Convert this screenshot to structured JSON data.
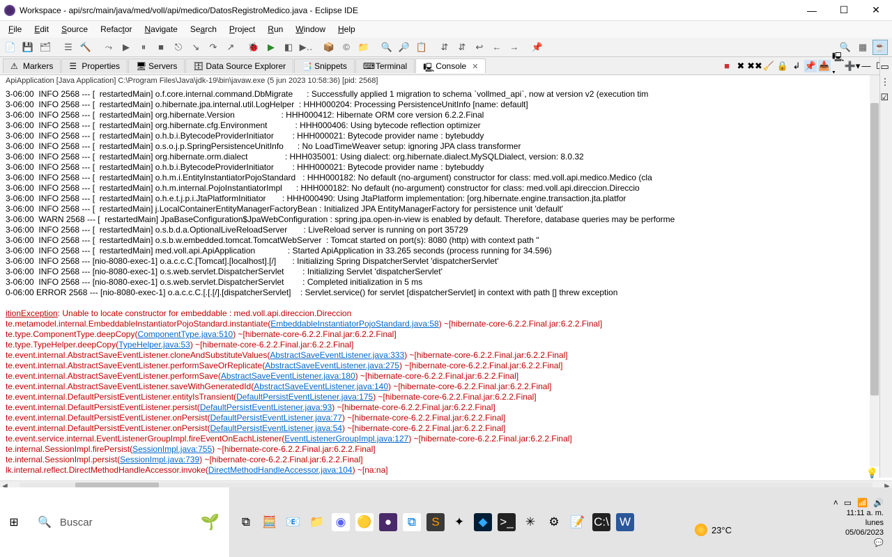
{
  "window": {
    "title": "Workspace - api/src/main/java/med/voll/api/medico/DatosRegistroMedico.java - Eclipse IDE"
  },
  "menu": {
    "file": "File",
    "edit": "Edit",
    "source": "Source",
    "refactor": "Refactor",
    "navigate": "Navigate",
    "search": "Search",
    "project": "Project",
    "run": "Run",
    "window": "Window",
    "help": "Help"
  },
  "tabs": {
    "markers": "Markers",
    "properties": "Properties",
    "servers": "Servers",
    "data_source_explorer": "Data Source Explorer",
    "snippets": "Snippets",
    "terminal": "Terminal",
    "console": "Console"
  },
  "console_header": "ApiApplication [Java Application] C:\\Program Files\\Java\\jdk-19\\bin\\javaw.exe (5 jun 2023 10:58:36) [pid: 2568]",
  "log_lines": [
    "3-06:00  INFO 2568 --- [  restartedMain] o.f.core.internal.command.DbMigrate      : Successfully applied 1 migration to schema `vollmed_api`, now at version v2 (execution tim",
    "3-06:00  INFO 2568 --- [  restartedMain] o.hibernate.jpa.internal.util.LogHelper  : HHH000204: Processing PersistenceUnitInfo [name: default]",
    "3-06:00  INFO 2568 --- [  restartedMain] org.hibernate.Version                    : HHH000412: Hibernate ORM core version 6.2.2.Final",
    "3-06:00  INFO 2568 --- [  restartedMain] org.hibernate.cfg.Environment            : HHH000406: Using bytecode reflection optimizer",
    "3-06:00  INFO 2568 --- [  restartedMain] o.h.b.i.BytecodeProviderInitiator        : HHH000021: Bytecode provider name : bytebuddy",
    "3-06:00  INFO 2568 --- [  restartedMain] o.s.o.j.p.SpringPersistenceUnitInfo      : No LoadTimeWeaver setup: ignoring JPA class transformer",
    "3-06:00  INFO 2568 --- [  restartedMain] org.hibernate.orm.dialect                : HHH035001: Using dialect: org.hibernate.dialect.MySQLDialect, version: 8.0.32",
    "3-06:00  INFO 2568 --- [  restartedMain] o.h.b.i.BytecodeProviderInitiator        : HHH000021: Bytecode provider name : bytebuddy",
    "3-06:00  INFO 2568 --- [  restartedMain] o.h.m.i.EntityInstantiatorPojoStandard   : HHH000182: No default (no-argument) constructor for class: med.voll.api.medico.Medico (cla",
    "3-06:00  INFO 2568 --- [  restartedMain] o.h.m.internal.PojoInstantiatorImpl      : HHH000182: No default (no-argument) constructor for class: med.voll.api.direccion.Direccio",
    "3-06:00  INFO 2568 --- [  restartedMain] o.h.e.t.j.p.i.JtaPlatformInitiator       : HHH000490: Using JtaPlatform implementation: [org.hibernate.engine.transaction.jta.platfor",
    "3-06:00  INFO 2568 --- [  restartedMain] j.LocalContainerEntityManagerFactoryBean : Initialized JPA EntityManagerFactory for persistence unit 'default'",
    "3-06:00  WARN 2568 --- [  restartedMain] JpaBaseConfiguration$JpaWebConfiguration : spring.jpa.open-in-view is enabled by default. Therefore, database queries may be performe",
    "3-06:00  INFO 2568 --- [  restartedMain] o.s.b.d.a.OptionalLiveReloadServer       : LiveReload server is running on port 35729",
    "3-06:00  INFO 2568 --- [  restartedMain] o.s.b.w.embedded.tomcat.TomcatWebServer  : Tomcat started on port(s): 8080 (http) with context path ''",
    "3-06:00  INFO 2568 --- [  restartedMain] med.voll.api.ApiApplication              : Started ApiApplication in 33.265 seconds (process running for 34.596)",
    "3-06:00  INFO 2568 --- [nio-8080-exec-1] o.a.c.c.C.[Tomcat].[localhost].[/]       : Initializing Spring DispatcherServlet 'dispatcherServlet'",
    "3-06:00  INFO 2568 --- [nio-8080-exec-1] o.s.web.servlet.DispatcherServlet        : Initializing Servlet 'dispatcherServlet'",
    "3-06:00  INFO 2568 --- [nio-8080-exec-1] o.s.web.servlet.DispatcherServlet        : Completed initialization in 5 ms",
    "0-06:00 ERROR 2568 --- [nio-8080-exec-1] o.a.c.c.C.[.[.[/].[dispatcherServlet]    : Servlet.service() for servlet [dispatcherServlet] in context with path [] threw exception"
  ],
  "stack": {
    "head_a": "itionException",
    "head_b": ": Unable to locate constructor for embeddable : med.voll.api.direccion.Direccion",
    "lines": [
      {
        "pre": "te.metamodel.internal.EmbeddableInstantiatorPojoStandard.instantiate(",
        "link": "EmbeddableInstantiatorPojoStandard.java:58",
        "post": ") ~[hibernate-core-6.2.2.Final.jar:6.2.2.Final]"
      },
      {
        "pre": "te.type.ComponentType.deepCopy(",
        "link": "ComponentType.java:510",
        "post": ") ~[hibernate-core-6.2.2.Final.jar:6.2.2.Final]"
      },
      {
        "pre": "te.type.TypeHelper.deepCopy(",
        "link": "TypeHelper.java:53",
        "post": ") ~[hibernate-core-6.2.2.Final.jar:6.2.2.Final]"
      },
      {
        "pre": "te.event.internal.AbstractSaveEventListener.cloneAndSubstituteValues(",
        "link": "AbstractSaveEventListener.java:333",
        "post": ") ~[hibernate-core-6.2.2.Final.jar:6.2.2.Final]"
      },
      {
        "pre": "te.event.internal.AbstractSaveEventListener.performSaveOrReplicate(",
        "link": "AbstractSaveEventListener.java:275",
        "post": ") ~[hibernate-core-6.2.2.Final.jar:6.2.2.Final]"
      },
      {
        "pre": "te.event.internal.AbstractSaveEventListener.performSave(",
        "link": "AbstractSaveEventListener.java:180",
        "post": ") ~[hibernate-core-6.2.2.Final.jar:6.2.2.Final]"
      },
      {
        "pre": "te.event.internal.AbstractSaveEventListener.saveWithGeneratedId(",
        "link": "AbstractSaveEventListener.java:140",
        "post": ") ~[hibernate-core-6.2.2.Final.jar:6.2.2.Final]"
      },
      {
        "pre": "te.event.internal.DefaultPersistEventListener.entityIsTransient(",
        "link": "DefaultPersistEventListener.java:175",
        "post": ") ~[hibernate-core-6.2.2.Final.jar:6.2.2.Final]"
      },
      {
        "pre": "te.event.internal.DefaultPersistEventListener.persist(",
        "link": "DefaultPersistEventListener.java:93",
        "post": ") ~[hibernate-core-6.2.2.Final.jar:6.2.2.Final]"
      },
      {
        "pre": "te.event.internal.DefaultPersistEventListener.onPersist(",
        "link": "DefaultPersistEventListener.java:77",
        "post": ") ~[hibernate-core-6.2.2.Final.jar:6.2.2.Final]"
      },
      {
        "pre": "te.event.internal.DefaultPersistEventListener.onPersist(",
        "link": "DefaultPersistEventListener.java:54",
        "post": ") ~[hibernate-core-6.2.2.Final.jar:6.2.2.Final]"
      },
      {
        "pre": "te.event.service.internal.EventListenerGroupImpl.fireEventOnEachListener(",
        "link": "EventListenerGroupImpl.java:127",
        "post": ") ~[hibernate-core-6.2.2.Final.jar:6.2.2.Final]"
      },
      {
        "pre": "te.internal.SessionImpl.firePersist(",
        "link": "SessionImpl.java:755",
        "post": ") ~[hibernate-core-6.2.2.Final.jar:6.2.2.Final]"
      },
      {
        "pre": "te.internal.SessionImpl.persist(",
        "link": "SessionImpl.java:739",
        "post": ") ~[hibernate-core-6.2.2.Final.jar:6.2.2.Final]"
      },
      {
        "pre": "lk.internal.reflect.DirectMethodHandleAccessor.invoke(",
        "link": "DirectMethodHandleAccessor.java:104",
        "post": ") ~[na:na]"
      }
    ]
  },
  "taskbar": {
    "search": "Buscar",
    "temp": "23°C",
    "time": "11:11 a. m.",
    "day": "lunes",
    "date": "05/06/2023"
  }
}
